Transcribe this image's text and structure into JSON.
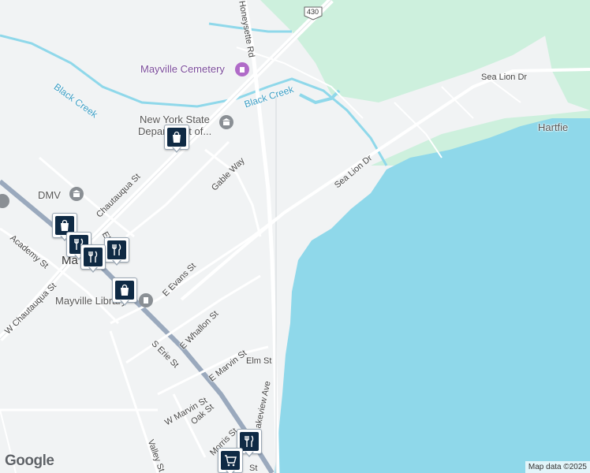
{
  "map": {
    "roads": {
      "chautauqua_st": "Chautauqua St",
      "w_chautauqua_st": "W Chautauqua St",
      "academy_st": "Academy St",
      "gable_way": "Gable Way",
      "e_evans_st": "E Evans St",
      "e_whallon_st": "E Whallon St",
      "s_erie_st": "S Erie St",
      "e_marvin_st": "E Marvin St",
      "elm_st": "Elm St",
      "w_marvin_st": "W Marvin St",
      "oak_st": "Oak St",
      "morris_st": "Morris St",
      "valley_st": "Valley St",
      "lakeview_ave": "Lakeview Ave",
      "sea_lion_dr_1": "Sea Lion Dr",
      "sea_lion_dr_2": "Sea Lion Dr",
      "honeysette_rd": "Honeysette Rd",
      "route_shield": "430",
      "partial_el": "El",
      "partial_st": "St"
    },
    "water": {
      "black_creek_1": "Black Creek",
      "black_creek_2": "Black Creek"
    },
    "places": {
      "cemetery": "Mayville Cemetery",
      "nys_dept_line1": "New York State",
      "nys_dept_line2": "Department of...",
      "dmv": "DMV",
      "library": "Mayville Library",
      "town_partial": "Ma",
      "hartfield_partial": "Hartfie"
    },
    "markers": [
      {
        "type": "shopping",
        "icon": "shopping-bag-icon"
      },
      {
        "type": "shopping",
        "icon": "shopping-bag-icon"
      },
      {
        "type": "restaurant",
        "icon": "fork-knife-icon"
      },
      {
        "type": "restaurant",
        "icon": "fork-knife-icon"
      },
      {
        "type": "restaurant",
        "icon": "fork-knife-icon"
      },
      {
        "type": "shopping",
        "icon": "shopping-bag-icon"
      },
      {
        "type": "restaurant",
        "icon": "fork-knife-icon"
      },
      {
        "type": "grocery",
        "icon": "shopping-cart-icon"
      }
    ],
    "colors": {
      "lake": "#8fd8ea",
      "park": "#cdf0dd",
      "land": "#f1f3f4",
      "marker_fill": "#0f2a44"
    },
    "branding": "Google",
    "attribution": "Map data ©2025"
  }
}
